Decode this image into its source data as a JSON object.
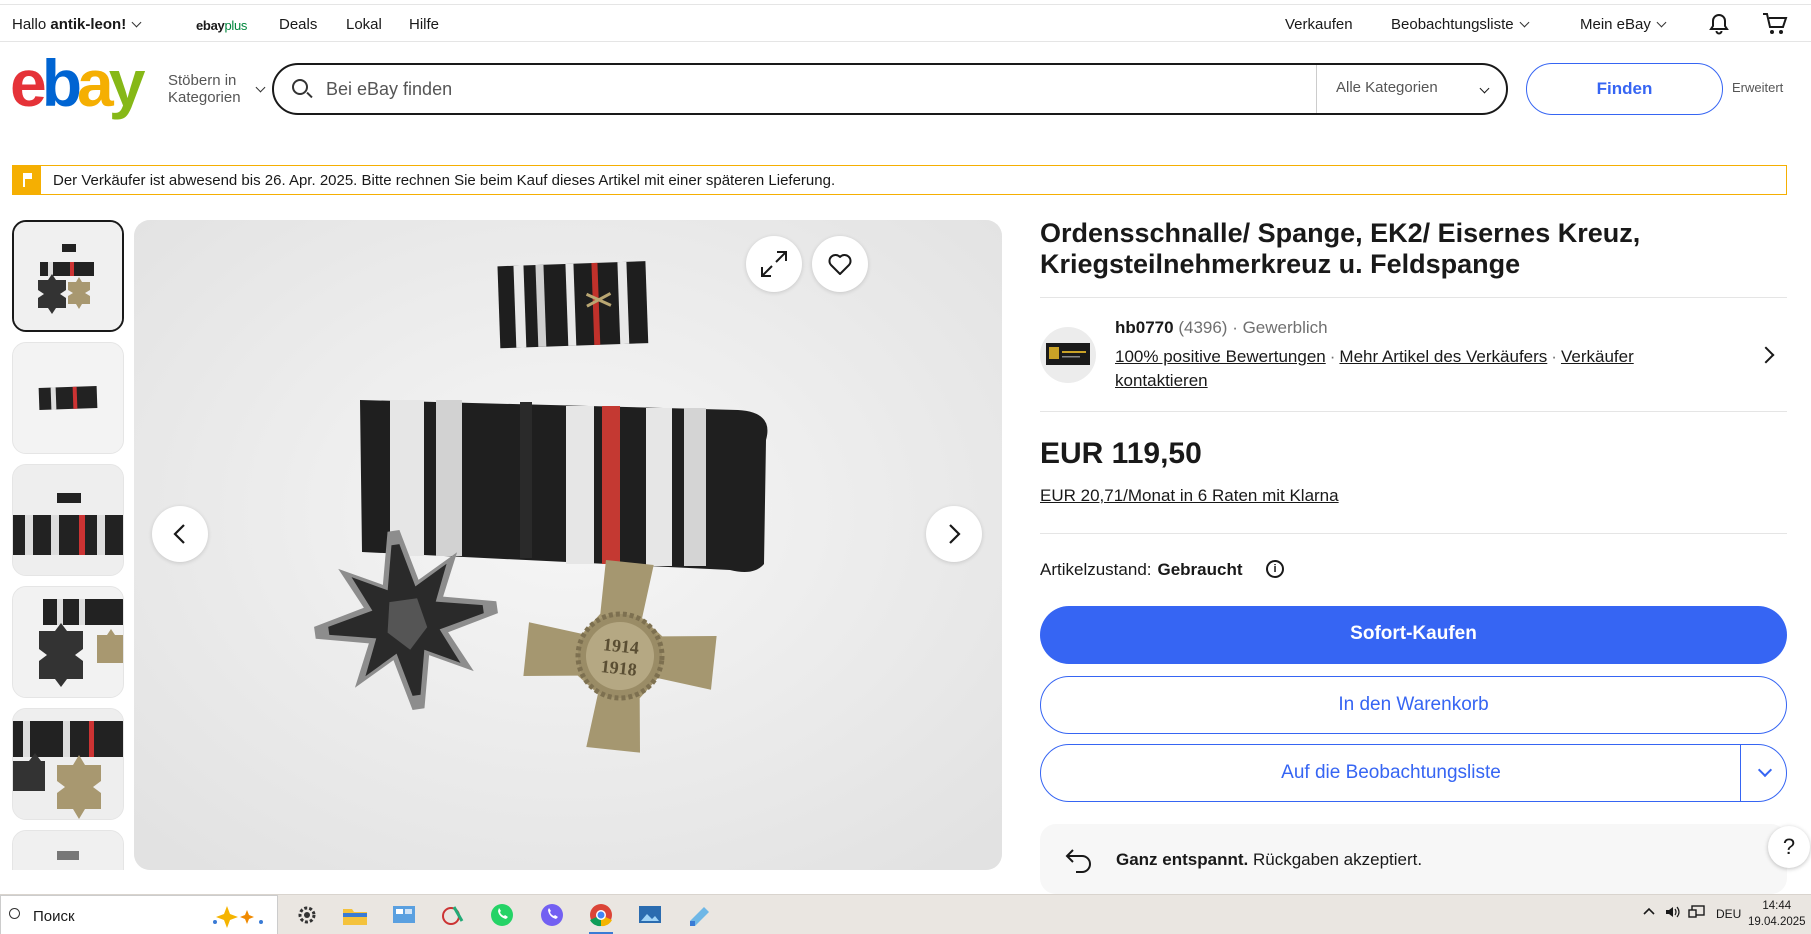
{
  "topnav": {
    "greeting_prefix": "Hallo ",
    "username": "antik-leon!",
    "ebayplus_e": "ebay",
    "ebayplus_p": "plus",
    "deals": "Deals",
    "lokal": "Lokal",
    "hilfe": "Hilfe",
    "verkaufen": "Verkaufen",
    "beobachtungsliste": "Beobachtungsliste",
    "mein_ebay": "Mein eBay",
    "icons": [
      "bell-icon",
      "cart-icon"
    ]
  },
  "header": {
    "logo": [
      "e",
      "b",
      "a",
      "y"
    ],
    "browse_line1": "Stöbern in",
    "browse_line2": "Kategorien",
    "search_placeholder": "Bei eBay finden",
    "category_select": "Alle Kategorien",
    "search_button": "Finden",
    "advanced": "Erweitert"
  },
  "notice": {
    "text": "Der Verkäufer ist abwesend bis 26. Apr. 2025. Bitte rechnen Sie beim Kauf dieses Artikel mit einer späteren Lieferung."
  },
  "gallery": {
    "thumb_count": 6,
    "selected_index": 0
  },
  "listing": {
    "title": "Ordensschnalle/ Spange, EK2/ Eisernes Kreuz, Kriegsteilnehmerkreuz u. Feldspange",
    "medal_text_top": "1914",
    "medal_text_bottom": "1918",
    "seller": {
      "name": "hb0770",
      "count": "(4396)",
      "sep": " · ",
      "type": "Gewerblich",
      "link1": "100% positive Bewertungen",
      "link2": "Mehr Artikel des Verkäufers",
      "link3": "Verkäufer kontaktieren"
    },
    "price": "EUR 119,50",
    "klarna": "EUR 20,71/Monat in 6 Raten mit Klarna",
    "condition_label": "Artikelzustand:",
    "condition_value": "Gebraucht",
    "buy_now": "Sofort-Kaufen",
    "add_to_cart": "In den Warenkorb",
    "watchlist": "Auf die Beobachtungsliste",
    "returns_bold": "Ganz entspannt.",
    "returns_text": " Rückgaben akzeptiert.",
    "help": "?"
  },
  "taskbar": {
    "search_text": "Поиск",
    "lang": "DEU",
    "time": "14:44",
    "date": "19.04.2025"
  },
  "colors": {
    "ebay_red": "#e53238",
    "ebay_blue": "#0064d2",
    "ebay_yellow": "#f5af02",
    "ebay_green": "#86b817",
    "accent": "#3665f3"
  }
}
